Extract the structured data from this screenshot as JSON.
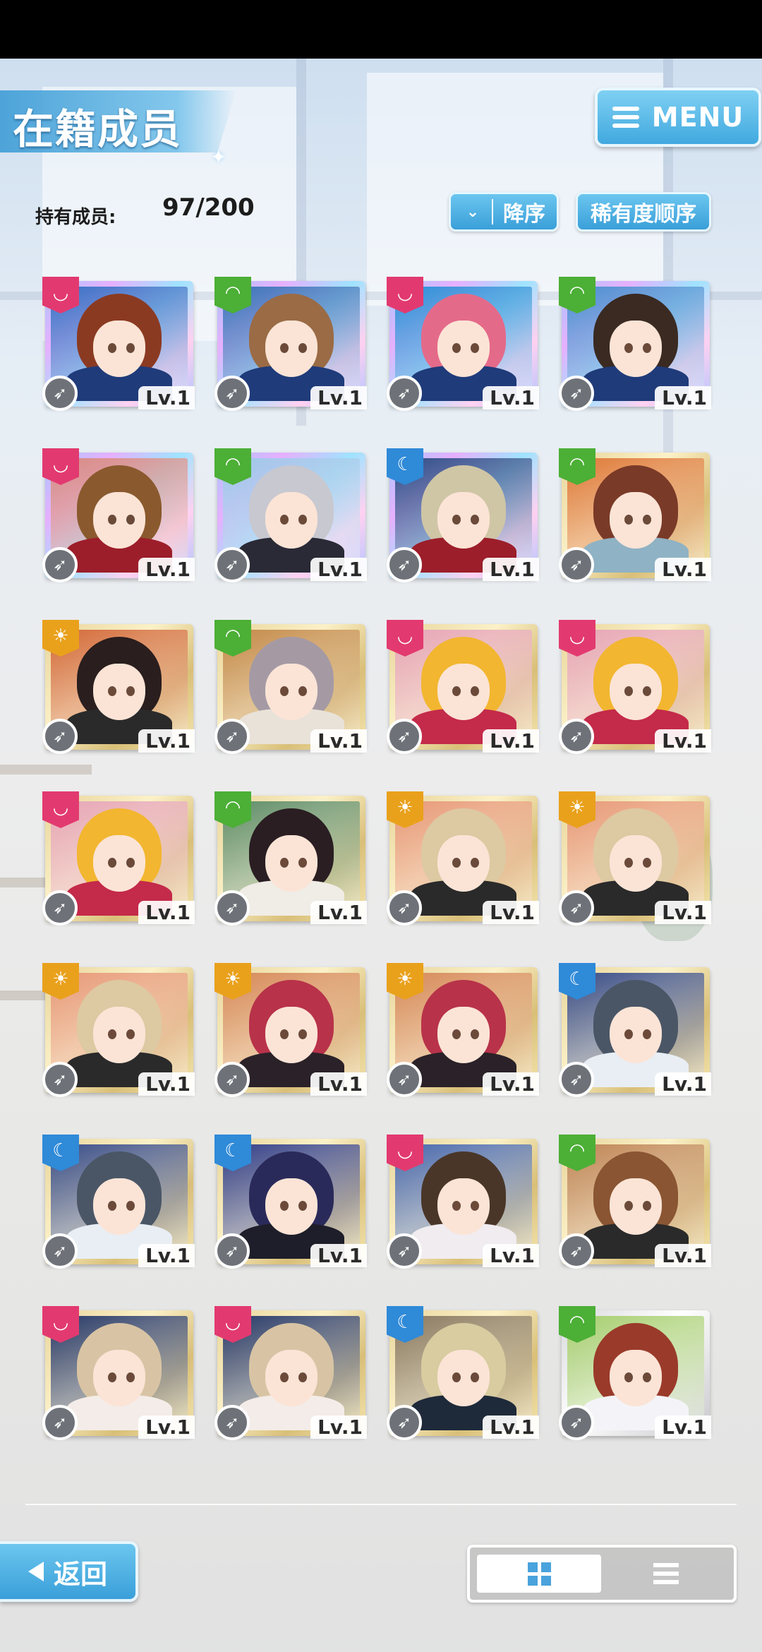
{
  "header": {
    "title": "在籍成员",
    "menu_label": "MENU"
  },
  "summary": {
    "owned_label": "持有成员:",
    "owned_value": "97/200"
  },
  "sort": {
    "order_label": "降序",
    "rarity_label": "稀有度顺序"
  },
  "colors": {
    "accent": "#41a9df",
    "attr_red": "#e23a70",
    "attr_green": "#4caf36",
    "attr_blue": "#2f8ad8",
    "attr_gold": "#e9a11c"
  },
  "members": [
    {
      "level": "Lv.1",
      "attr": "red",
      "frame": "rainbow",
      "hair": "#8b3a22",
      "body": "#1f3b7a",
      "bg": "#3a6fc4"
    },
    {
      "level": "Lv.1",
      "attr": "green",
      "frame": "rainbow",
      "hair": "#9a6b45",
      "body": "#1f3b7a",
      "bg": "#3b73b8"
    },
    {
      "level": "Lv.1",
      "attr": "red",
      "frame": "rainbow",
      "hair": "#e46a8a",
      "body": "#1f3b7a",
      "bg": "#2c8fd6"
    },
    {
      "level": "Lv.1",
      "attr": "green",
      "frame": "rainbow",
      "hair": "#3a2a22",
      "body": "#1f3b7a",
      "bg": "#4d8fd0"
    },
    {
      "level": "Lv.1",
      "attr": "red",
      "frame": "rainbow",
      "hair": "#8a5a2e",
      "body": "#9c1e2a",
      "bg": "#d98a82"
    },
    {
      "level": "Lv.1",
      "attr": "green",
      "frame": "rainbow",
      "hair": "#c8c8d0",
      "body": "#2a2a36",
      "bg": "#9fc7e8"
    },
    {
      "level": "Lv.1",
      "attr": "blue",
      "frame": "rainbow",
      "hair": "#cfc6a6",
      "body": "#9c1e2a",
      "bg": "#2f4d86"
    },
    {
      "level": "Lv.1",
      "attr": "green",
      "frame": "gold",
      "hair": "#7a3a28",
      "body": "#8fb2c4",
      "bg": "#e07a3a"
    },
    {
      "level": "Lv.1",
      "attr": "gold",
      "frame": "gold",
      "hair": "#2a1e1e",
      "body": "#2a2a2a",
      "bg": "#d46a3a"
    },
    {
      "level": "Lv.1",
      "attr": "green",
      "frame": "gold",
      "hair": "#a59aa4",
      "body": "#e9e2d8",
      "bg": "#c48a4a"
    },
    {
      "level": "Lv.1",
      "attr": "red",
      "frame": "gold",
      "hair": "#f2b630",
      "body": "#c42a4a",
      "bg": "#e7a6b8"
    },
    {
      "level": "Lv.1",
      "attr": "red",
      "frame": "gold",
      "hair": "#f2b630",
      "body": "#c42a4a",
      "bg": "#e7a6b8"
    },
    {
      "level": "Lv.1",
      "attr": "red",
      "frame": "gold",
      "hair": "#f2b630",
      "body": "#c42a4a",
      "bg": "#e7a6b8"
    },
    {
      "level": "Lv.1",
      "attr": "green",
      "frame": "gold",
      "hair": "#2a1e22",
      "body": "#f0ece6",
      "bg": "#5f8e6a"
    },
    {
      "level": "Lv.1",
      "attr": "gold",
      "frame": "gold",
      "hair": "#ddc9a2",
      "body": "#2a2a2a",
      "bg": "#e89a7a"
    },
    {
      "level": "Lv.1",
      "attr": "gold",
      "frame": "gold",
      "hair": "#ddc9a2",
      "body": "#2a2a2a",
      "bg": "#e89a7a"
    },
    {
      "level": "Lv.1",
      "attr": "gold",
      "frame": "gold",
      "hair": "#ddc9a2",
      "body": "#2a2a2a",
      "bg": "#e89a7a"
    },
    {
      "level": "Lv.1",
      "attr": "gold",
      "frame": "gold",
      "hair": "#b8324a",
      "body": "#2a2228",
      "bg": "#d78a5a"
    },
    {
      "level": "Lv.1",
      "attr": "gold",
      "frame": "gold",
      "hair": "#b8324a",
      "body": "#2a2228",
      "bg": "#d78a5a"
    },
    {
      "level": "Lv.1",
      "attr": "blue",
      "frame": "gold",
      "hair": "#4a5666",
      "body": "#e8eef4",
      "bg": "#3a4e8a"
    },
    {
      "level": "Lv.1",
      "attr": "blue",
      "frame": "gold",
      "hair": "#4a5666",
      "body": "#e8eef4",
      "bg": "#3a4e8a"
    },
    {
      "level": "Lv.1",
      "attr": "blue",
      "frame": "gold",
      "hair": "#2a2a5a",
      "body": "#1e1e2a",
      "bg": "#33408a"
    },
    {
      "level": "Lv.1",
      "attr": "red",
      "frame": "gold",
      "hair": "#4a3628",
      "body": "#f0ecf0",
      "bg": "#4a6ab0"
    },
    {
      "level": "Lv.1",
      "attr": "green",
      "frame": "gold",
      "hair": "#8a5532",
      "body": "#2a2a2a",
      "bg": "#c08658"
    },
    {
      "level": "Lv.1",
      "attr": "red",
      "frame": "gold",
      "hair": "#d8c4a4",
      "body": "#f4ece8",
      "bg": "#283a6a"
    },
    {
      "level": "Lv.1",
      "attr": "red",
      "frame": "gold",
      "hair": "#d8c4a4",
      "body": "#f4ece8",
      "bg": "#283a6a"
    },
    {
      "level": "Lv.1",
      "attr": "blue",
      "frame": "gold",
      "hair": "#d8cca0",
      "body": "#1e2a3a",
      "bg": "#8a7a62"
    },
    {
      "level": "Lv.1",
      "attr": "green",
      "frame": "silver",
      "hair": "#9a3a2a",
      "body": "#f4f4f8",
      "bg": "#a8d070"
    }
  ],
  "footer": {
    "back_label": "返回",
    "view_grid_icon": "grid-icon",
    "view_list_icon": "list-icon"
  }
}
